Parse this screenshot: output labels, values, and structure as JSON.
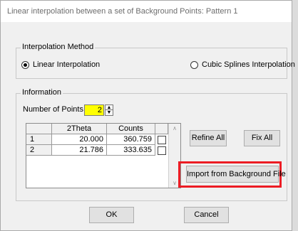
{
  "window": {
    "title": "Linear interpolation between a set of Background Points: Pattern 1"
  },
  "interpolation": {
    "group_title": "Interpolation Method",
    "linear_label": "Linear Interpolation",
    "cubic_label": "Cubic Splines Interpolation",
    "selected": "linear"
  },
  "information": {
    "group_title": "Information",
    "num_points_label": "Number of Points:",
    "num_points_value": "2",
    "table": {
      "columns": [
        "2Theta",
        "Counts"
      ],
      "rows": [
        {
          "index": "1",
          "theta": "20.000",
          "counts": "360.759"
        },
        {
          "index": "2",
          "theta": "21.786",
          "counts": "333.635"
        }
      ]
    },
    "refine_all_label": "Refine All",
    "fix_all_label": "Fix All",
    "import_label": "Import from Background File"
  },
  "footer": {
    "ok_label": "OK",
    "cancel_label": "Cancel"
  },
  "colors": {
    "highlight": "#ec1c24",
    "input_bg": "#ffff00"
  }
}
